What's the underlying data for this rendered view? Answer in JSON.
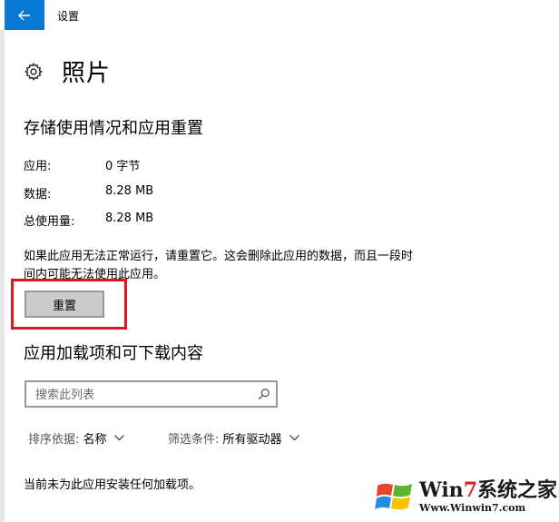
{
  "window": {
    "title": "设置"
  },
  "app": {
    "name": "照片"
  },
  "storage": {
    "heading": "存储使用情况和应用重置",
    "rows": [
      {
        "label": "应用:",
        "value": "0 字节"
      },
      {
        "label": "数据:",
        "value": "8.28 MB"
      },
      {
        "label": "总使用量:",
        "value": "8.28 MB"
      }
    ],
    "reset_description": "如果此应用无法正常运行，请重置它。这会删除此应用的数据，而且一段时间内可能无法使用此应用。",
    "reset_label": "重置"
  },
  "addons": {
    "heading": "应用加载项和可下载内容",
    "search_placeholder": "搜索此列表",
    "sort_label": "排序依据:",
    "sort_value": "名称",
    "filter_label": "筛选条件:",
    "filter_value": "所有驱动器",
    "empty_text": "当前未为此应用安装任何加载项。"
  },
  "watermark": {
    "brand_prefix": "Win",
    "brand_seven": "7",
    "brand_suffix": "系统之家",
    "url": "Www.Winwin7.com"
  },
  "colors": {
    "accent": "#0a78d7",
    "highlight": "#e0141e"
  },
  "icons": {
    "back": "back-arrow-icon",
    "settings": "gear-icon",
    "search": "search-icon",
    "dropdown": "chevron-down-icon"
  }
}
